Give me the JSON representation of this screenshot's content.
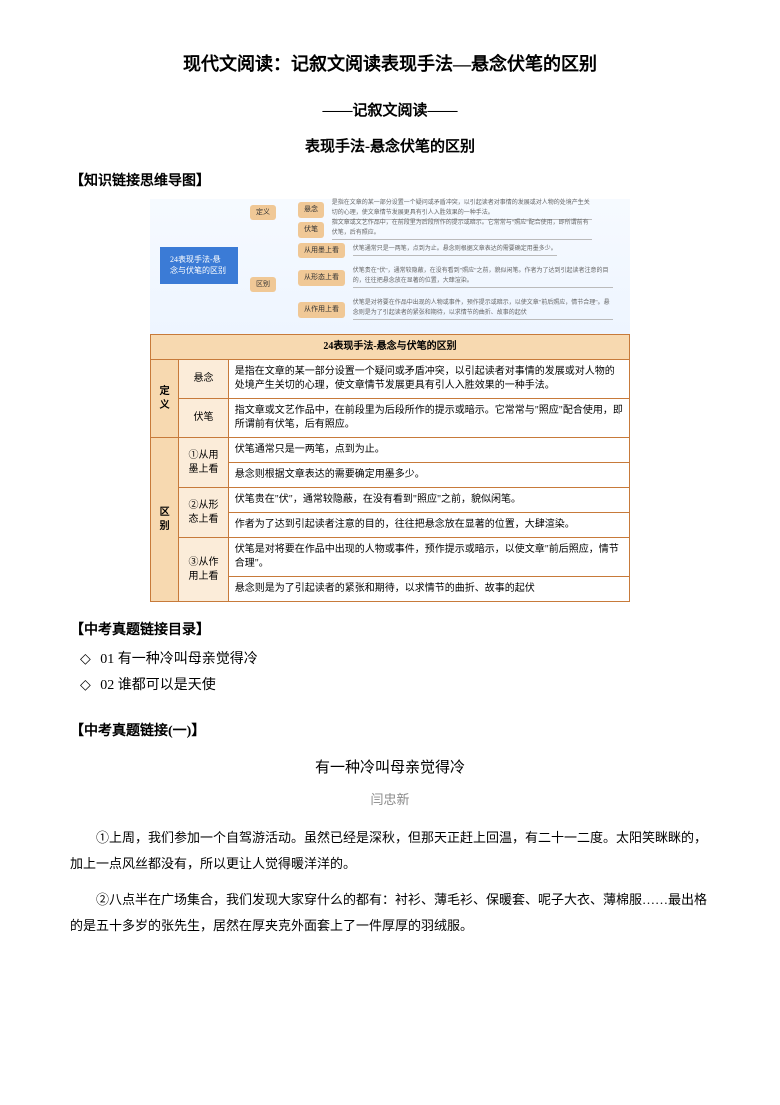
{
  "main_title": "现代文阅读：记叙文阅读表现手法—悬念伏笔的区别",
  "sub_title_1": "——记叙文阅读——",
  "sub_title_2": "表现手法-悬念伏笔的区别",
  "section_mindmap": "【知识链接思维导图】",
  "mindmap": {
    "root": "24表现手法-悬念与伏笔的区别",
    "branches": [
      {
        "label": "定义",
        "children": [
          {
            "label": "悬念",
            "note": "是指在文章的某一部分设置一个疑问或矛盾冲突，以引起读者对事情的发展或对人物的处境产生关切的心理，使文章情节发展更具有引人入胜效果的一种手法。"
          },
          {
            "label": "伏笔",
            "note": "指文章或文艺作品中，在前段里为后段所作的提示或暗示。它常常与\"照应\"配合使用，即所谓前有伏笔，后有照应。"
          }
        ]
      },
      {
        "label": "区别",
        "children": [
          {
            "label": "从用墨上看",
            "note": "伏笔通常只是一两笔，点到为止。悬念则根据文章表达的需要确定用墨多少。"
          },
          {
            "label": "从形态上看",
            "note": "伏笔贵在\"伏\"，通常较隐蔽，在没有看到\"照应\"之前，貌似闲笔。作者为了达到引起读者注意的目的，往往把悬念放在显著的位置，大肆渲染。"
          },
          {
            "label": "从作用上看",
            "note": "伏笔是对将要在作品中出现的人物或事件，预作提示或暗示，以使文章\"前后照应，情节合理\"。悬念则是为了引起读者的紧张和期待，以求情节的曲折、故事的起伏"
          }
        ]
      }
    ]
  },
  "table": {
    "title": "24表现手法-悬念与伏笔的区别",
    "rows": [
      {
        "group": "定义",
        "sub": "悬念",
        "text": "是指在文章的某一部分设置一个疑问或矛盾冲突，以引起读者对事情的发展或对人物的处境产生关切的心理，使文章情节发展更具有引人入胜效果的一种手法。"
      },
      {
        "group": "定义",
        "sub": "伏笔",
        "text": "指文章或文艺作品中，在前段里为后段所作的提示或暗示。它常常与\"照应\"配合使用，即所谓前有伏笔，后有照应。"
      },
      {
        "group": "区别",
        "sub": "①从用墨上看",
        "text_a": "伏笔通常只是一两笔，点到为止。",
        "text_b": "悬念则根据文章表达的需要确定用墨多少。"
      },
      {
        "group": "区别",
        "sub": "②从形态上看",
        "text_a": "伏笔贵在\"伏\"，通常较隐蔽，在没有看到\"照应\"之前，貌似闲笔。",
        "text_b": "作者为了达到引起读者注意的目的，往往把悬念放在显著的位置，大肆渲染。"
      },
      {
        "group": "区别",
        "sub": "③从作用上看",
        "text_a": "伏笔是对将要在作品中出现的人物或事件，预作提示或暗示，以使文章\"前后照应，情节合理\"。",
        "text_b": "悬念则是为了引起读者的紧张和期待，以求情节的曲折、故事的起伏"
      }
    ]
  },
  "section_toc": "【中考真题链接目录】",
  "toc": [
    {
      "marker": "◇",
      "num": "01",
      "text": "有一种冷叫母亲觉得冷"
    },
    {
      "marker": "◇",
      "num": "02",
      "text": "谁都可以是天使"
    }
  ],
  "section_link1": "【中考真题链接(一)】",
  "article": {
    "title": "有一种冷叫母亲觉得冷",
    "author": "闫忠新",
    "paras": [
      "①上周，我们参加一个自驾游活动。虽然已经是深秋，但那天正赶上回温，有二十一二度。太阳笑眯眯的，加上一点风丝都没有，所以更让人觉得暖洋洋的。",
      "②八点半在广场集合，我们发现大家穿什么的都有：衬衫、薄毛衫、保暖套、呢子大衣、薄棉服……最出格的是五十多岁的张先生，居然在厚夹克外面套上了一件厚厚的羽绒服。"
    ]
  }
}
